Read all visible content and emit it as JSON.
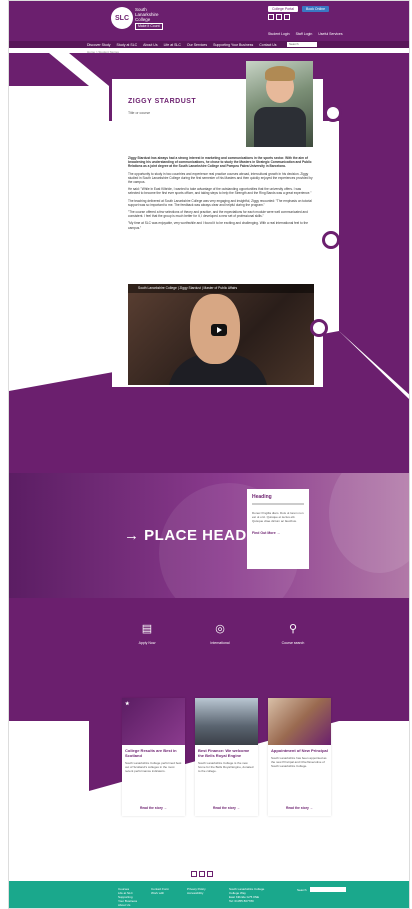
{
  "header": {
    "logo_text": "SLC",
    "brand_lines": [
      "South",
      "Lanarkshire",
      "College"
    ],
    "brand_tag": "Make it Count",
    "top_links": [
      "College Portal",
      "Book Online"
    ],
    "utility_links": [
      "Student Login",
      "Staff Login",
      "Useful Services"
    ]
  },
  "nav": {
    "items": [
      "Discover Study",
      "Study at SLC",
      "About Us",
      "Life at SLC",
      "Our Services",
      "Supporting Your Business",
      "Contact Us"
    ],
    "search_placeholder": "Search"
  },
  "breadcrumb": "Home > Student Stories",
  "profile": {
    "name": "ZIGGY STARDUST",
    "subtitle": "Title or course",
    "lead": "Ziggy Stardust has always had a strong interest in marketing and communications in the sports sector. With the aim of broadening his understanding of communications, he chose to study the Masters in Strategic Communication and Public Relations as a joint degree at the South Lanarkshire College and Pompeu Fabra University in Barcelona.",
    "paragraphs": [
      "The opportunity to study in two countries and experience real practice courses abroad, intercultural growth in his decision. Ziggy studied in South Lanarkshire College during the first semester of his Masters and then quickly enjoyed the experiences provided by the campus.",
      "He said: \"While in East Kilbride, I wanted to take advantage of the outstanding opportunities that the university offers. I was selected to become the first ever sports officer, and taking steps to help the Strength and the Ring Bands was a great experience.\"",
      "The teaching delivered at South Lanarkshire College was very engaging and insightful, Ziggy recounted: \"The emphasis on tutorial support was so important to me. The feedback was always clear and helpful during the program.\"",
      "\"The course offered a few selections of theory and practice, and the expectations for each module were well communicated and consistent. I feel that the group is much better for it, I developed a new set of professional skills.\"",
      "\"My time at SLC was enjoyable, very worthwhile and I found it to be exciting and challenging. With a real international feel to the campus.\""
    ],
    "video_title": "South Lanarkshire College | Ziggy Stardust | Master of Public Affairs"
  },
  "banner": {
    "title": "PLACE HEADLINE",
    "arrow": "→",
    "card_heading": "Heading",
    "card_text": "Donec fringilla diam. Duis ut lorem non est ut orci. Quisque et lectus elit. Quisque vitae dictum ac faucibus.",
    "card_link": "Find Out More  →"
  },
  "quick_links": [
    {
      "icon": "document-icon",
      "label": "Apply Now"
    },
    {
      "icon": "globe-icon",
      "label": "International"
    },
    {
      "icon": "search-icon",
      "label": "Course search"
    }
  ],
  "news": [
    {
      "title": "College Results are Best in Scotland",
      "text": "South Lanarkshire College performed best out of Scotland's colleges in the most recent performance indicators.",
      "link": "Read the story  →"
    },
    {
      "title": "Best Finance: We welcome the Bells Royal Engine",
      "text": "South Lanarkshire College is the new home for the Bells Royal Engine, donated to the college.",
      "link": "Read the story  →"
    },
    {
      "title": "Appointment of New Principal",
      "text": "South Lanarkshire has been appointed as the new Principal and Chief Executive of South Lanarkshire College.",
      "link": "Read the story  →"
    }
  ],
  "footer": {
    "col1": [
      "Courses",
      "Life at SLC",
      "Supporting",
      "Your Business",
      "About Us"
    ],
    "col2": [
      "Contact Form",
      "Work with"
    ],
    "col3": [
      "Privacy Policy",
      "Accessibility"
    ],
    "col4": [
      "South Lanarkshire College",
      "College Way",
      "East Kilbride G75 0NE",
      "",
      "Tel: 01355 807780"
    ],
    "search_label": "Search"
  }
}
